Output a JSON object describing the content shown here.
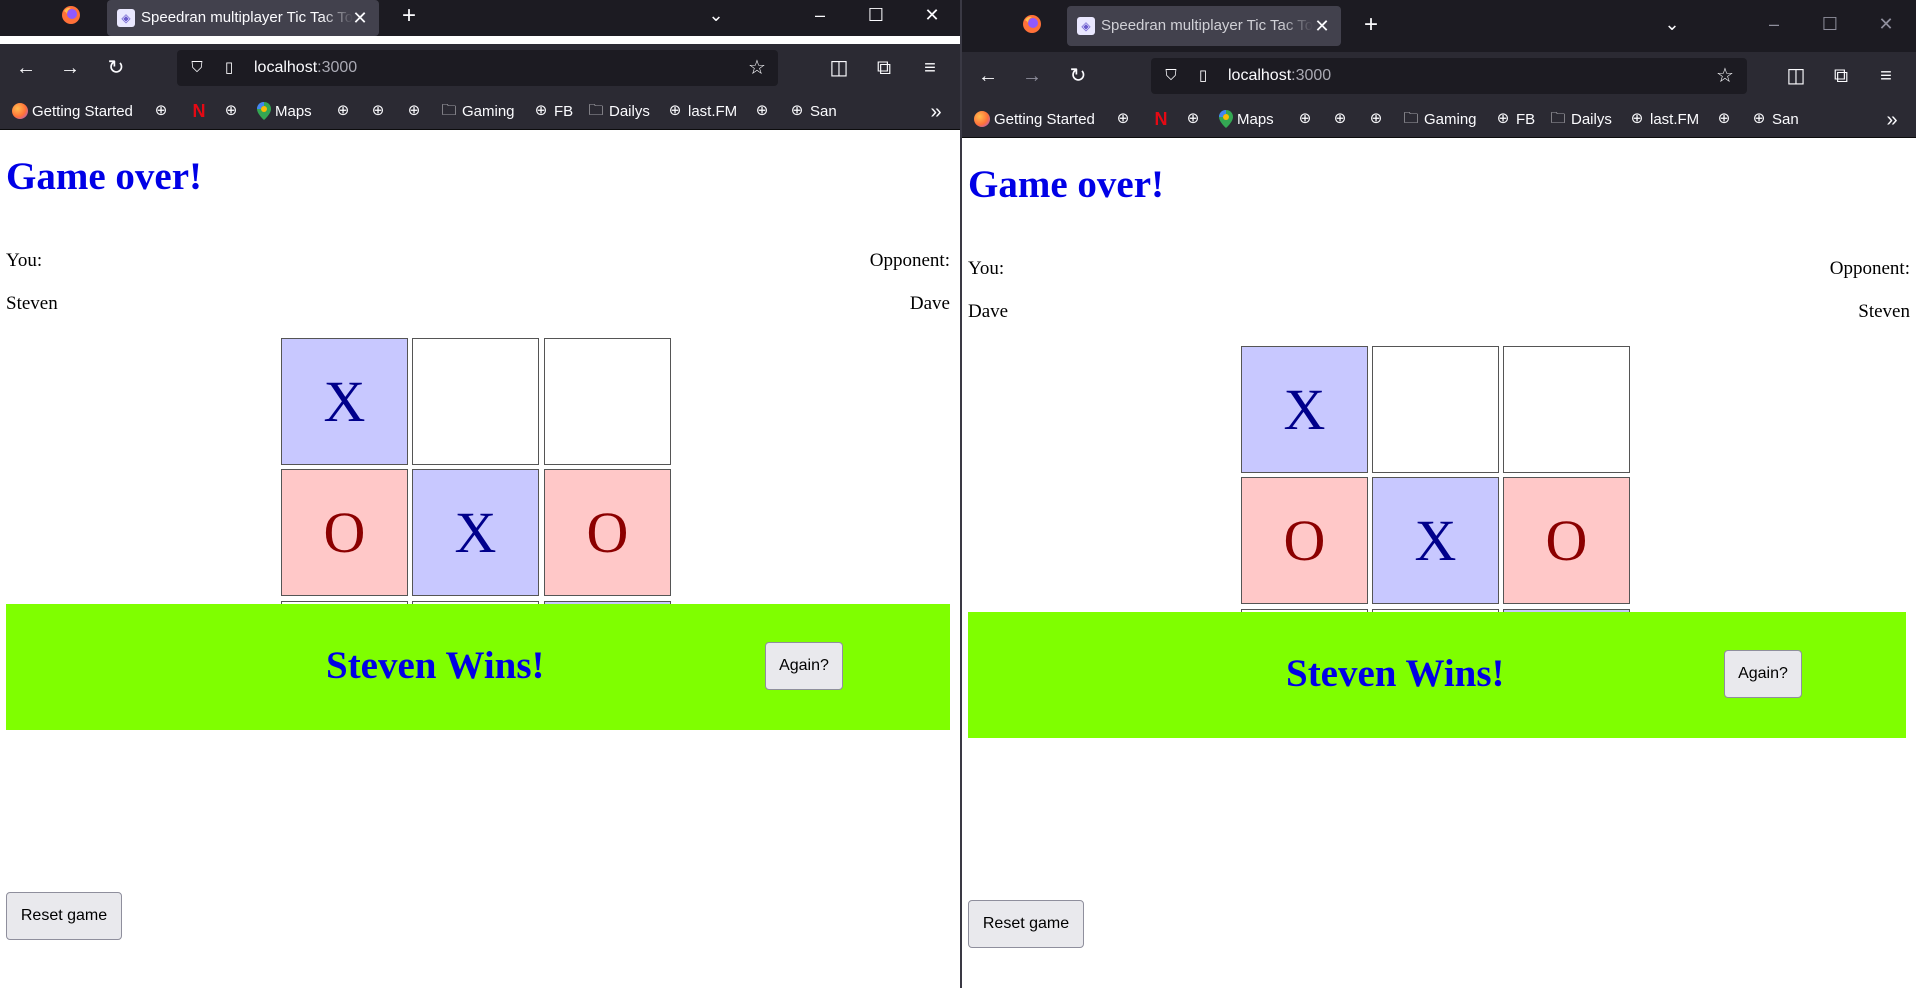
{
  "browser": {
    "tab_title": "Speedran multiplayer Tic Tac Toe",
    "url_host": "localhost",
    "url_port": ":3000",
    "bookmarks": [
      "Getting Started",
      "Maps",
      "Gaming",
      "FB",
      "Dailys",
      "last.FM",
      "San"
    ]
  },
  "game": {
    "heading": "Game over!",
    "you_label": "You:",
    "opponent_label": "Opponent:",
    "win_text": "Steven Wins!",
    "again_button": "Again?",
    "reset_button": "Reset game",
    "board": [
      "X",
      "",
      "",
      "O",
      "X",
      "O",
      "",
      "",
      ""
    ],
    "colors": {
      "x_bg": "#c8c8ff",
      "o_bg": "#ffc8c8",
      "banner_bg": "#7fff00",
      "heading": "#0000e6"
    }
  },
  "left_window": {
    "you_name": "Steven",
    "opponent_name": "Dave"
  },
  "right_window": {
    "you_name": "Dave",
    "opponent_name": "Steven"
  },
  "icons": [
    "firefox-icon",
    "tab-favicon-icon",
    "close-icon",
    "plus-icon",
    "chevron-down-icon",
    "minimize-icon",
    "maximize-icon",
    "back-icon",
    "forward-icon",
    "reload-icon",
    "shield-icon",
    "page-icon",
    "star-icon",
    "pocket-icon",
    "extensions-icon",
    "menu-icon",
    "globe-icon",
    "netflix-icon",
    "maps-icon",
    "folder-icon",
    "overflow-chevron-icon"
  ]
}
